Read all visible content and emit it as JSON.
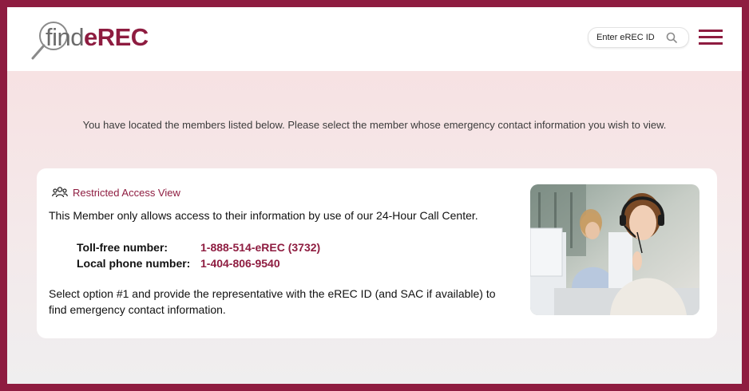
{
  "brand": {
    "logo_find": "find",
    "logo_erec": "eREC",
    "accent_color": "#8e1c40"
  },
  "header": {
    "search": {
      "placeholder": "Enter eREC ID",
      "icon": "search-icon"
    },
    "menu_icon": "hamburger-menu-icon"
  },
  "intro": {
    "text": "You have located the members listed below. Please select the member whose emergency contact information you wish to view."
  },
  "card": {
    "icon": "users-icon",
    "title": "Restricted Access View",
    "line1": "This Member only allows access to their information by use of our 24-Hour Call Center.",
    "phones": [
      {
        "label": "Toll-free number:",
        "value": "1-888-514-eREC (3732)"
      },
      {
        "label": "Local phone number:",
        "value": "1-404-806-9540"
      }
    ],
    "line3": "Select option #1 and provide the representative with the eREC ID (and SAC if available) to find emergency contact information."
  }
}
